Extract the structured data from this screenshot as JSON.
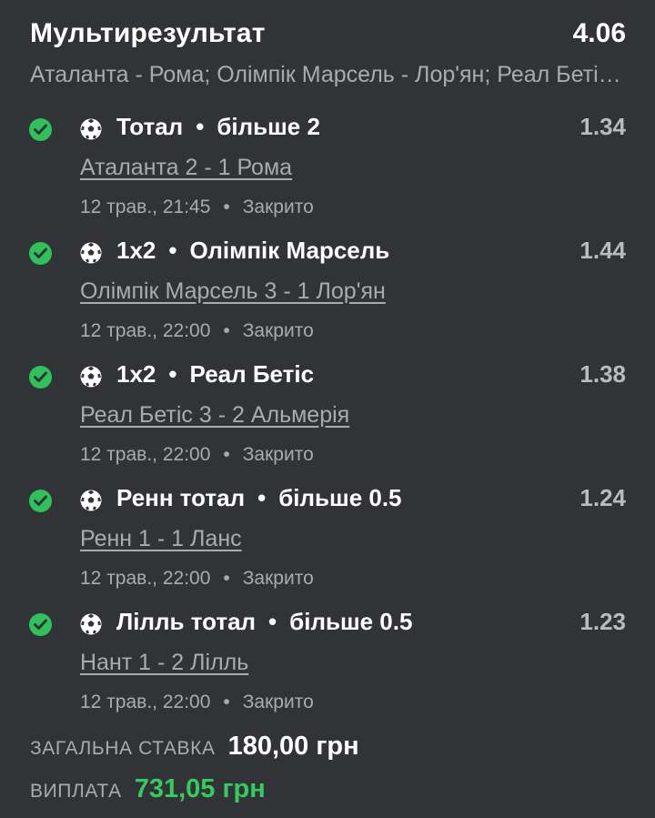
{
  "header": {
    "title": "Мультирезультат",
    "total_odds": "4.06",
    "subtitle": "Аталанта - Рома; Олімпік Марсель - Лор'ян; Реал Бетіс - Альмерія; Ренн - Ланс; Нант - Лілль"
  },
  "bets": [
    {
      "status_icon": "check-circle-icon",
      "sport_icon": "soccer-ball-icon",
      "market": "Тотал",
      "selection": "більше 2",
      "odds": "1.34",
      "match": "Аталанта 2 - 1 Рома",
      "date": "12 трав., 21:45",
      "state": "Закрито"
    },
    {
      "status_icon": "check-circle-icon",
      "sport_icon": "soccer-ball-icon",
      "market": "1x2",
      "selection": "Олімпік Марсель",
      "odds": "1.44",
      "match": "Олімпік Марсель 3 - 1 Лор'ян",
      "date": "12 трав., 22:00",
      "state": "Закрито"
    },
    {
      "status_icon": "check-circle-icon",
      "sport_icon": "soccer-ball-icon",
      "market": "1x2",
      "selection": "Реал Бетіс",
      "odds": "1.38",
      "match": "Реал Бетіс 3 - 2 Альмерія",
      "date": "12 трав., 22:00",
      "state": "Закрито"
    },
    {
      "status_icon": "check-circle-icon",
      "sport_icon": "soccer-ball-icon",
      "market": "Ренн тотал",
      "selection": "більше 0.5",
      "odds": "1.24",
      "match": "Ренн 1 - 1 Ланс",
      "date": "12 трав., 22:00",
      "state": "Закрито"
    },
    {
      "status_icon": "check-circle-icon",
      "sport_icon": "soccer-ball-icon",
      "market": "Лілль тотал",
      "selection": "більше 0.5",
      "odds": "1.23",
      "match": "Нант 1 - 2 Лілль",
      "date": "12 трав., 22:00",
      "state": "Закрито"
    }
  ],
  "summary": {
    "stake_label": "ЗАГАЛЬНА СТАВКА",
    "stake_value": "180,00 грн",
    "payout_label": "ВИПЛАТА",
    "payout_value": "731,05 грн"
  },
  "colors": {
    "background": "#323336",
    "success": "#2fc25a",
    "payout": "#35cc5f",
    "muted_text": "#a9abb0"
  }
}
